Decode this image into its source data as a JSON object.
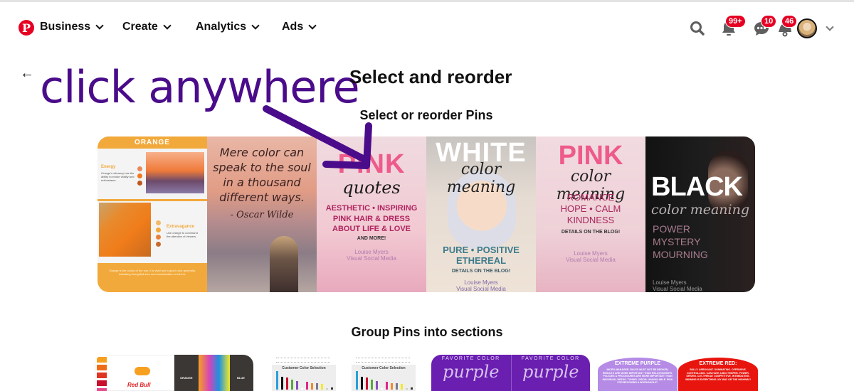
{
  "header": {
    "logo_letter": "P",
    "nav": [
      {
        "label": "Business"
      },
      {
        "label": "Create"
      },
      {
        "label": "Analytics"
      },
      {
        "label": "Ads"
      }
    ],
    "badges": {
      "notifications": "99+",
      "messages": "10",
      "updates": "46"
    },
    "brand_color": "#e60023"
  },
  "annotation": {
    "text": "click anywhere",
    "color": "#4a0c8a"
  },
  "page": {
    "back_icon": "←",
    "title": "Select and reorder",
    "subtitle": "Select or reorder Pins",
    "group_title": "Group Pins into sections"
  },
  "pins": [
    {
      "header": "ORANGE",
      "energy_title": "Energy",
      "energy_text": "Orange's vibrancy has the ability to evoke vitality and enthusiasm.",
      "extra_title": "Extravagance",
      "extra_text": "Use orange to command the attention of viewers.",
      "footer": "Orange is the colour of the sun. It is vivid and a good color generally, indicating thoughtfulness and consideration of others."
    },
    {
      "quote": "Mere color can speak to the soul in a thousand different ways.",
      "author": "- Oscar Wilde"
    },
    {
      "big": "PINK",
      "script": "quotes",
      "lines": [
        "AESTHETIC • INSPIRING",
        "PINK HAIR & DRESS",
        "ABOUT LIFE & LOVE"
      ],
      "small": "AND MORE!",
      "brand_1": "Louise Myers",
      "brand_2": "Visual Social Media"
    },
    {
      "big": "WHITE",
      "script": "color meaning",
      "lines": [
        "PURE • POSITIVE",
        "ETHEREAL"
      ],
      "small": "DETAILS ON THE BLOG!",
      "brand_1": "Louise Myers",
      "brand_2": "Visual Social Media"
    },
    {
      "big": "PINK",
      "script": "color meaning",
      "lines": [
        "ROMANCE",
        "HOPE • CALM",
        "KINDNESS"
      ],
      "small": "DETAILS ON THE BLOG!",
      "brand_1": "Louise Myers",
      "brand_2": "Visual Social Media"
    },
    {
      "big": "BLACK",
      "script": "color meaning",
      "lines": [
        "POWER",
        "MYSTERY",
        "MOURNING"
      ],
      "brand_1": "Louise Myers",
      "brand_2": "Visual Social Media"
    }
  ],
  "groups": [
    {
      "brand": "Red Bull",
      "label_left": "ORANGE",
      "label_right": "BLUE"
    },
    {
      "chart_title": "Customer Color Selection"
    },
    {
      "chart_title": "Customer Color Selection"
    },
    {
      "top": "FAVORITE COLOR",
      "script": "purple"
    },
    {
      "left_title": "EXTREME PURPLE",
      "left_text": "MICRO-MANAGER. RULES MUST NOT BE BROKEN. RESULTS ARE MORE IMPORTANT THAN RELATIONSHIPS. POLICIES & PROCEDURES ARE MORE IMPORTANT THAN INDIVIDUAL NEEDS. TUNNEL VISION. UNAVAILABLE. RISK FOR BECOMING A WORKAHOLIC.",
      "right_title": "EXTREME RED:",
      "right_text": "BULLY. ARROGANT. DOMINATING. OFFENSIVE. CONTROLLING. CAN HAVE A BIG TEMPER. POWER-DRIVEN. CUT-THROAT COMPETITIVE. INTIMIDATING. WINNING IS EVERYTHING. MY WAY OR THE HIGHWAY!"
    }
  ]
}
